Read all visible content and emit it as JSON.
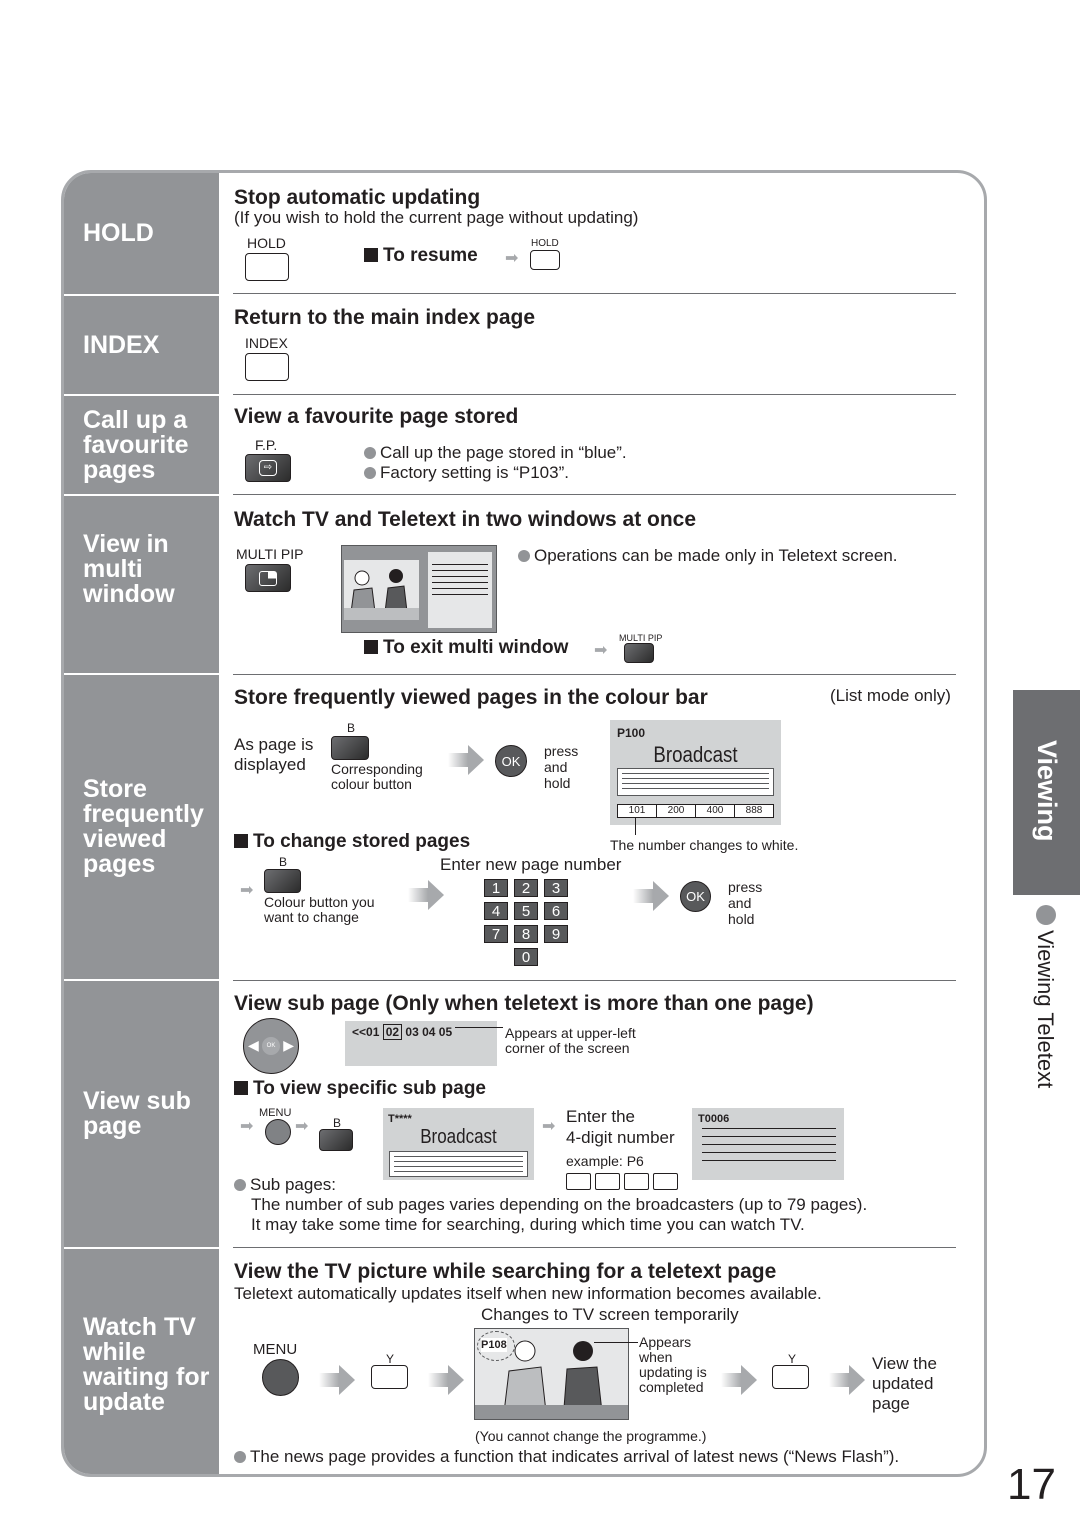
{
  "page_number": "17",
  "side_tab": {
    "label": "Viewing",
    "subsection": "Viewing Teletext"
  },
  "left_labels": [
    "HOLD",
    "INDEX",
    "Call up a favourite pages",
    "View in multi window",
    "Store frequently viewed pages",
    "View sub page",
    "Watch TV while waiting for update"
  ],
  "hold": {
    "title": "Stop automatic updating",
    "desc": "(If you wish to hold the current page without updating)",
    "button_label": "HOLD",
    "resume_label": "To resume",
    "resume_button_label": "HOLD"
  },
  "index": {
    "title": "Return to the main index page",
    "button_label": "INDEX"
  },
  "favourite": {
    "title": "View a favourite page stored",
    "button_label": "F.P.",
    "notes": [
      "Call up the page stored in “blue”.",
      "Factory setting is “P103”."
    ]
  },
  "multi": {
    "title": "Watch TV and Teletext in two windows at once",
    "button_label": "MULTI PIP",
    "note": "Operations can be made only in Teletext screen.",
    "exit_label": "To exit multi window",
    "exit_button_label": "MULTI PIP"
  },
  "store": {
    "title": "Store frequently viewed pages in the colour bar",
    "mode_note": "(List mode only)",
    "as_page_line1": "As page is",
    "as_page_line2": "displayed",
    "colour_key": "B",
    "corresponding_line1": "Corresponding",
    "corresponding_line2": "colour button",
    "ok_label": "OK",
    "press_hold": [
      "press",
      "and",
      "hold"
    ],
    "screen_page": "P100",
    "screen_title": "Broadcast",
    "colour_bar": [
      "101",
      "200",
      "400",
      "888"
    ],
    "changes_note": "The number changes to white.",
    "change_title": "To change stored pages",
    "change_key": "B",
    "change_button_line1": "Colour button you",
    "change_button_line2": "want to change",
    "enter_label": "Enter new page number",
    "keypad": [
      "1",
      "2",
      "3",
      "4",
      "5",
      "6",
      "7",
      "8",
      "9",
      "0"
    ],
    "ok2_label": "OK",
    "press_hold2": [
      "press",
      "and",
      "hold"
    ]
  },
  "subpage": {
    "title": "View sub page (Only when teletext is more than one page)",
    "ok_label": "OK",
    "nav_prefix": "<<01",
    "nav_current": "02",
    "nav_rest": "03 04 05",
    "appears_line1": "Appears at upper-left",
    "appears_line2": "corner of the screen",
    "specific_title": "To view specific sub page",
    "menu_label": "MENU",
    "b_label": "B",
    "screen_code": "T****",
    "screen_title": "Broadcast",
    "enter_line1": "Enter the",
    "enter_line2": "4-digit number",
    "example": "example: P6",
    "result_code": "T0006",
    "sub_pages_label": "Sub pages:",
    "sub_note1": "The number of sub pages varies depending on the broadcasters (up to 79 pages).",
    "sub_note2": "It may take some time for searching, during which time you can watch TV."
  },
  "update": {
    "title": "View the TV picture while searching for a teletext page",
    "desc": "Teletext automatically updates itself when new information becomes available.",
    "changes_label": "Changes to TV screen temporarily",
    "menu_label": "MENU",
    "y_label": "Y",
    "page_code": "P108",
    "appears": [
      "Appears",
      "when",
      "updating is",
      "completed"
    ],
    "y2_label": "Y",
    "view_updated": [
      "View the",
      "updated",
      "page"
    ],
    "cannot_change": "(You cannot change the programme.)",
    "news_note": "The news page provides a function that indicates arrival of latest news (“News Flash”)."
  }
}
